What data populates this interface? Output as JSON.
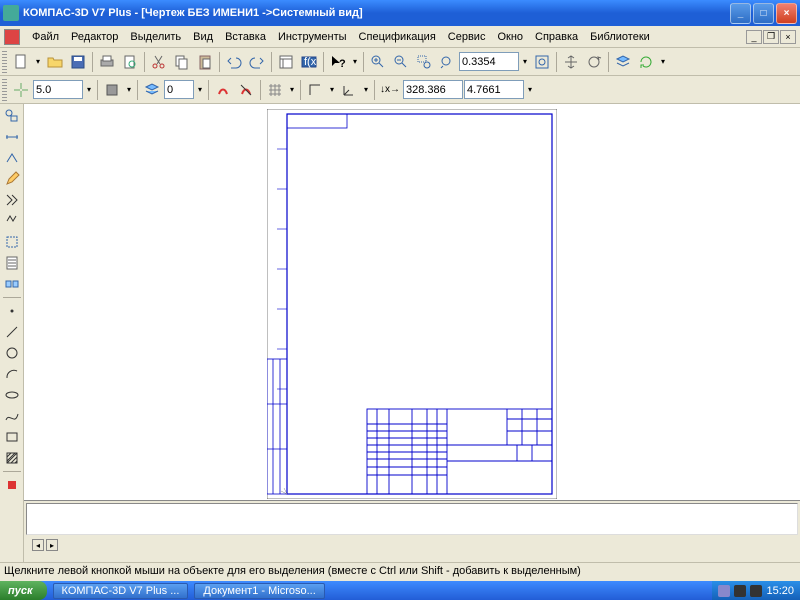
{
  "title": "КОМПАС-3D V7 Plus - [Чертеж БЕЗ ИМЕНИ1 ->Системный вид]",
  "menu": {
    "file": "Файл",
    "edit": "Редактор",
    "select": "Выделить",
    "view": "Вид",
    "insert": "Вставка",
    "tools": "Инструменты",
    "spec": "Спецификация",
    "service": "Сервис",
    "window": "Окно",
    "help": "Справка",
    "lib": "Библиотеки"
  },
  "toolbar1": {
    "zoom": "0.3354"
  },
  "toolbar2": {
    "step": "5.0",
    "style": "0",
    "coordx": "328.386",
    "coordy": "4.7661"
  },
  "status": "Щелкните левой кнопкой мыши на объекте для его выделения (вместе с Ctrl или Shift - добавить к выделенным)",
  "taskbar": {
    "start": "пуск",
    "t1": "КОМПАС-3D V7 Plus ...",
    "t2": "Документ1 - Microso...",
    "clock": "15:20"
  }
}
